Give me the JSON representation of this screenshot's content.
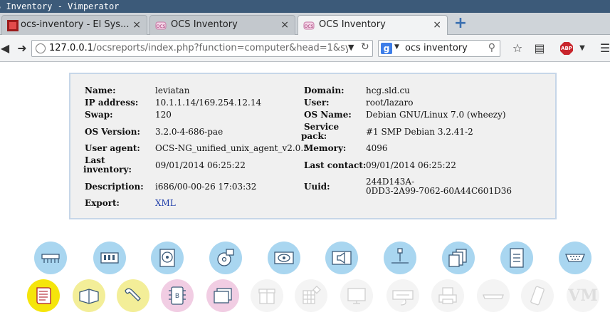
{
  "window": {
    "title": "S Inventory - Vimperator"
  },
  "tabs": [
    {
      "label": "ocs-inventory - El Sys...",
      "close": "×"
    },
    {
      "label": "OCS Inventory",
      "close": "×"
    },
    {
      "label": "OCS Inventory",
      "close": "×"
    }
  ],
  "new_tab": "+",
  "nav": {
    "url_host": "127.0.0.1",
    "url_path": "/ocsreports/index.php?function=computer&head=1&sy",
    "search_value": "ocs inventory",
    "abp_label": "ABP"
  },
  "computer": {
    "left": [
      {
        "label": "Name:",
        "value": "leviatan"
      },
      {
        "label": "IP address:",
        "value": "10.1.1.14/169.254.12.14"
      },
      {
        "label": "Swap:",
        "value": "120"
      },
      {
        "label": "OS Version:",
        "value": "3.2.0-4-686-pae"
      },
      {
        "label": "User agent:",
        "value": "OCS-NG_unified_unix_agent_v2.0.5"
      },
      {
        "label_line1": "Last",
        "label_line2": "inventory:",
        "value": "09/01/2014 06:25:22"
      },
      {
        "label": "Description:",
        "value": "i686/00-00-26 17:03:32"
      },
      {
        "label": "Export:",
        "value": "XML"
      }
    ],
    "right": [
      {
        "label": "Domain:",
        "value": "hcg.sld.cu"
      },
      {
        "label": "User:",
        "value": "root/lazaro"
      },
      {
        "label": "OS Name:",
        "value": "Debian GNU/Linux 7.0 (wheezy)"
      },
      {
        "label_line1": "Service",
        "label_line2": "pack:",
        "value": "#1 SMP Debian 3.2.41-2"
      },
      {
        "label": "Memory:",
        "value": "4096"
      },
      {
        "label": "Last contact:",
        "value": "09/01/2014 06:25:22"
      },
      {
        "label": "Uuid:",
        "value_line1": "244D143A-",
        "value_line2": "0DD3-2A99-7062-60A44C601D36"
      }
    ]
  },
  "icons": {
    "row1": [
      "bios-icon",
      "memory-icon",
      "storage-icon",
      "drive-icon",
      "video-icon",
      "sound-icon",
      "network-icon",
      "controllers-icon",
      "slots-icon",
      "ports-icon"
    ],
    "row2": [
      "software-icon",
      "registry-icon",
      "admin-tools-icon",
      "printers-icon",
      "folders-icon",
      "packages-icon",
      "inputs-icon",
      "monitor-icon",
      "keyboard-icon",
      "printer-icon",
      "modem-icon",
      "sim-icon"
    ],
    "vm_label": "VM",
    "bios_label": "B"
  },
  "colors": {
    "panel_border": "#c6d6e8",
    "panel_bg": "#f0f0f0",
    "icon_blue": "#a9d6f0",
    "icon_yellow": "#f3ee98",
    "icon_pink": "#f1cde3",
    "link": "#1c3ba8"
  }
}
